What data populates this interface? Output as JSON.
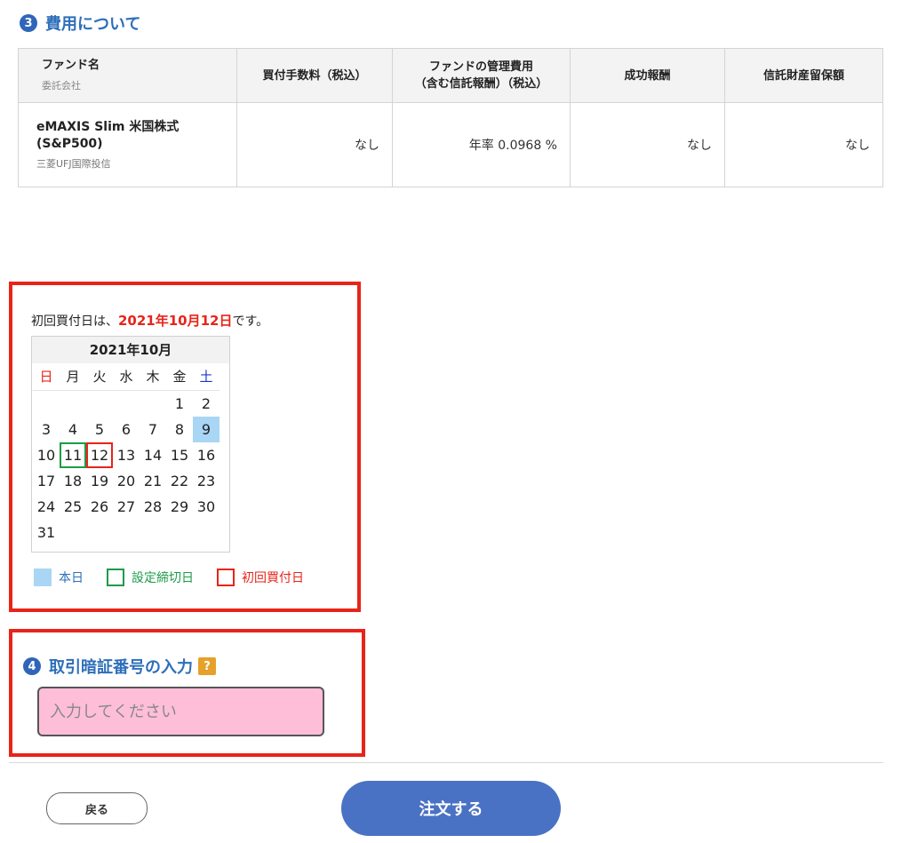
{
  "cost_section": {
    "number": "3",
    "title": "費用について",
    "table": {
      "headers": {
        "fund_name": "ファンド名",
        "company": "委託会社",
        "purchase_fee": "買付手数料（税込）",
        "mgmt_fee_line1": "ファンドの管理費用",
        "mgmt_fee_line2": "（含む信託報酬）（税込）",
        "success_fee": "成功報酬",
        "retention": "信託財産留保額"
      },
      "row": {
        "fund_name_line1": "eMAXIS Slim 米国株式",
        "fund_name_line2": "(S&P500)",
        "company": "三菱UFJ国際投信",
        "purchase_fee": "なし",
        "mgmt_fee": "年率 0.0968 %",
        "success_fee": "なし",
        "retention": "なし"
      }
    }
  },
  "first_purchase": {
    "prefix": "初回買付日は、",
    "date": "2021年10月12日",
    "suffix": "です。"
  },
  "calendar": {
    "title": "2021年10月",
    "weekdays": [
      "日",
      "月",
      "火",
      "水",
      "木",
      "金",
      "土"
    ],
    "weeks": [
      [
        "",
        "",
        "",
        "",
        "",
        "1",
        "2"
      ],
      [
        "3",
        "4",
        "5",
        "6",
        "7",
        "8",
        "9"
      ],
      [
        "10",
        "11",
        "12",
        "13",
        "14",
        "15",
        "16"
      ],
      [
        "17",
        "18",
        "19",
        "20",
        "21",
        "22",
        "23"
      ],
      [
        "24",
        "25",
        "26",
        "27",
        "28",
        "29",
        "30"
      ],
      [
        "31",
        "",
        "",
        "",
        "",
        "",
        ""
      ]
    ],
    "today": "9",
    "deadline": "11",
    "first_buy": "12"
  },
  "legend": {
    "today": "本日",
    "deadline": "設定締切日",
    "first_buy": "初回買付日"
  },
  "pin_section": {
    "number": "4",
    "title": "取引暗証番号の入力",
    "help": "?",
    "placeholder": "入力してください",
    "value": ""
  },
  "buttons": {
    "back": "戻る",
    "order": "注文する"
  },
  "colors": {
    "accent_blue": "#2e6fba",
    "highlight_red": "#e8241a",
    "deadline_green": "#1e9b4a",
    "today_blue": "#a9d6f5",
    "input_pink": "#ffbed8",
    "order_button": "#4a72c4"
  }
}
